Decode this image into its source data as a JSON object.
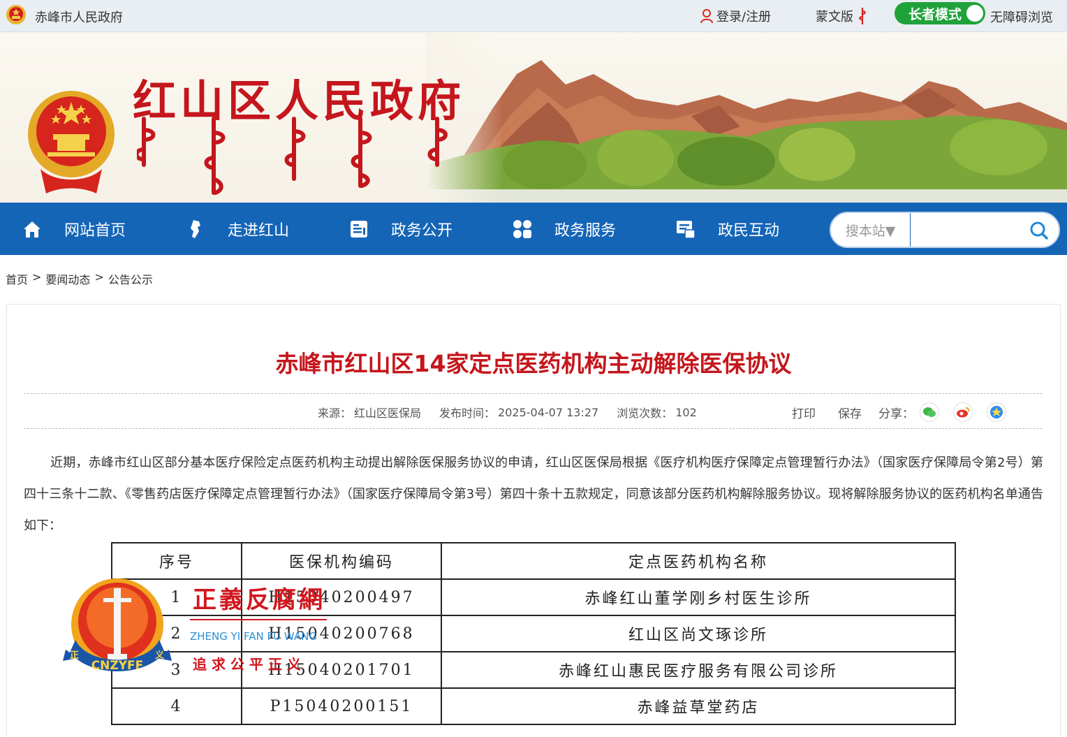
{
  "topbar": {
    "site_name": "赤峰市人民政府",
    "login": "登录/注册",
    "mongolian": "蒙文版",
    "elder_mode": "长者模式",
    "accessible": "无障碍浏览"
  },
  "banner": {
    "title": "红山区人民政府"
  },
  "nav": [
    {
      "label": "网站首页",
      "icon": "home-icon"
    },
    {
      "label": "走进红山",
      "icon": "map-icon"
    },
    {
      "label": "政务公开",
      "icon": "document-icon"
    },
    {
      "label": "政务服务",
      "icon": "grid-icon"
    },
    {
      "label": "政民互动",
      "icon": "chat-icon"
    }
  ],
  "search": {
    "scope": "搜本站▼",
    "placeholder": ""
  },
  "breadcrumb": [
    "首页",
    "要闻动态",
    "公告公示"
  ],
  "article": {
    "title": "赤峰市红山区14家定点医药机构主动解除医保协议",
    "source_label": "来源：",
    "source": "红山区医保局",
    "time_label": "发布时间：",
    "time": "2025-04-07 13:27",
    "views_label": "浏览次数：",
    "views": "102",
    "print": "打印",
    "save": "保存",
    "share": "分享：",
    "share_icons": [
      "wechat-icon",
      "weibo-icon",
      "qzone-icon"
    ],
    "body": "近期，赤峰市红山区部分基本医疗保险定点医药机构主动提出解除医保服务协议的申请，红山区医保局根据《医疗机构医疗保障定点管理暂行办法》（国家医疗保障局令第2号）第四十三条十二款、《零售药店医疗保障定点管理暂行办法》（国家医疗保障局令第3号）第四十条十五款规定，同意该部分医药机构解除服务协议。现将解除服务协议的医药机构名单通告如下："
  },
  "table": {
    "headers": [
      "序号",
      "医保机构编码",
      "定点医药机构名称"
    ],
    "rows": [
      [
        "1",
        "H15040200497",
        "赤峰红山董学刚乡村医生诊所"
      ],
      [
        "2",
        "H15040200768",
        "红山区尚文琢诊所"
      ],
      [
        "3",
        "H15040201701",
        "赤峰红山惠民医疗服务有限公司诊所"
      ],
      [
        "4",
        "P15040200151",
        "赤峰益草堂药店"
      ]
    ]
  },
  "watermark": {
    "name": "正義反腐網",
    "pinyin": "ZHENG YI FAN FU WANG",
    "slogan": "追 求 公 平 正 义",
    "badge": "CNZYFF",
    "badge_left": "正",
    "badge_right": "义"
  }
}
